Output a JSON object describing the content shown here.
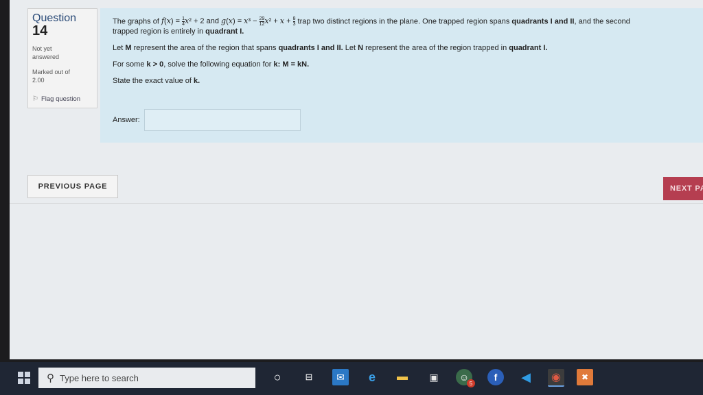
{
  "question_info": {
    "label": "Question",
    "number": "14",
    "status_line1": "Not yet",
    "status_line2": "answered",
    "marked_line1": "Marked out of",
    "marked_value": "2.00",
    "flag_label": "Flag question"
  },
  "question_text": {
    "p1_a": "The graphs of ",
    "p1_b": " trap two distinct regions in the plane. One trapped region spans ",
    "p1_bold1": "quadrants I and II",
    "p1_c": ", and the second",
    "p1_line2": "trapped region is entirely in ",
    "p1_bold2": "quadrant I.",
    "p2_a": "Let ",
    "p2_M": "M",
    "p2_b": " represent the area of the region that spans ",
    "p2_bold": "quadrants I and II.",
    "p2_c": " Let ",
    "p2_N": "N",
    "p2_d": " represent the area of the region trapped in ",
    "p2_bold2": "quadrant I.",
    "p3_a": "For some ",
    "p3_bold": "k > 0",
    "p3_b": ", solve the following equation for ",
    "p3_bold2": "k: M = kN.",
    "p4_a": "State the exact value of ",
    "p4_bold": "k."
  },
  "answer": {
    "label": "Answer:",
    "value": ""
  },
  "nav": {
    "previous": "PREVIOUS PAGE",
    "next": "NEXT PA"
  },
  "taskbar": {
    "search_placeholder": "Type here to search",
    "badge_count": "5"
  },
  "colors": {
    "question_bg": "#d6e9f2",
    "next_bg": "#b53e50",
    "taskbar_bg": "#1f2634"
  }
}
